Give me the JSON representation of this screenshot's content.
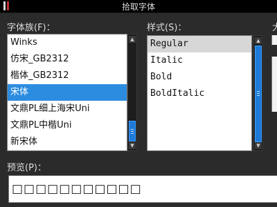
{
  "window": {
    "title": "拾取字体"
  },
  "font_family": {
    "label": "字体族(F)：",
    "items": [
      "Winks",
      "仿宋_GB2312",
      "楷体_GB2312",
      "宋体",
      "文鼎PL细上海宋Uni",
      "文鼎PL中楷Uni",
      "新宋体"
    ],
    "selected_index": 3,
    "scroll_position": 0.9
  },
  "style": {
    "label": "样式(S)：",
    "items": [
      "Regular",
      "Italic",
      "Bold",
      "BoldItalic"
    ],
    "selected_index": 0,
    "scroll_position": 0.3
  },
  "size": {
    "label_partial": "大"
  },
  "preview": {
    "label": "预览(P)：",
    "text": "□□□□□□□□□□□"
  },
  "colors": {
    "selection": "#2c8ce0",
    "inactive_selection": "#d7d7d7",
    "scroll_thumb": "#1e7ad6",
    "background": "#2b2b2b"
  }
}
